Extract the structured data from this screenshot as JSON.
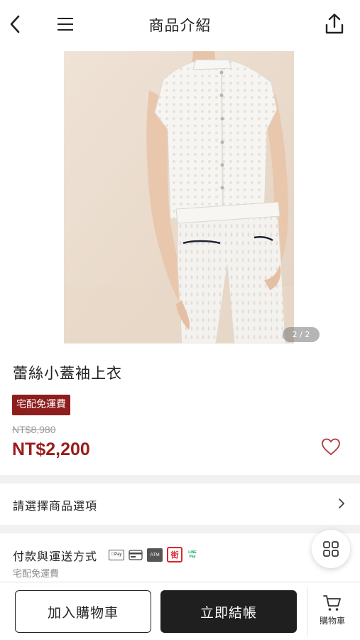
{
  "header": {
    "title": "商品介紹",
    "back_icon": "chevron-left-icon",
    "menu_icon": "hamburger-menu-icon",
    "share_icon": "share-upload-icon"
  },
  "gallery": {
    "page_indicator": "2 / 2",
    "current_page": 2,
    "total_pages": 2
  },
  "product": {
    "name": "蕾絲小蓋袖上衣",
    "badge": "宅配免運費",
    "original_price": "NT$8,980",
    "sale_price": "NT$2,200",
    "favorite_icon": "heart-outline-icon"
  },
  "options": {
    "label": "請選擇商品選項",
    "chevron_icon": "chevron-right-icon"
  },
  "payment": {
    "label": "付款與運送方式",
    "sub": "宅配免運費",
    "icons": {
      "apple_pay": "Pay",
      "card": "card-icon",
      "atm": "ATM",
      "store": "街",
      "line_pay": "LINE Pay"
    }
  },
  "floating": {
    "grid_icon": "grid-icon"
  },
  "bottom_bar": {
    "add_to_cart": "加入購物車",
    "checkout": "立即結帳",
    "cart_label": "購物車"
  },
  "colors": {
    "accent_red": "#9b1c1c",
    "badge_bg": "#8e1d1d",
    "checkout_bg": "#1f1f1f",
    "image_bg": "#ece0d3"
  }
}
